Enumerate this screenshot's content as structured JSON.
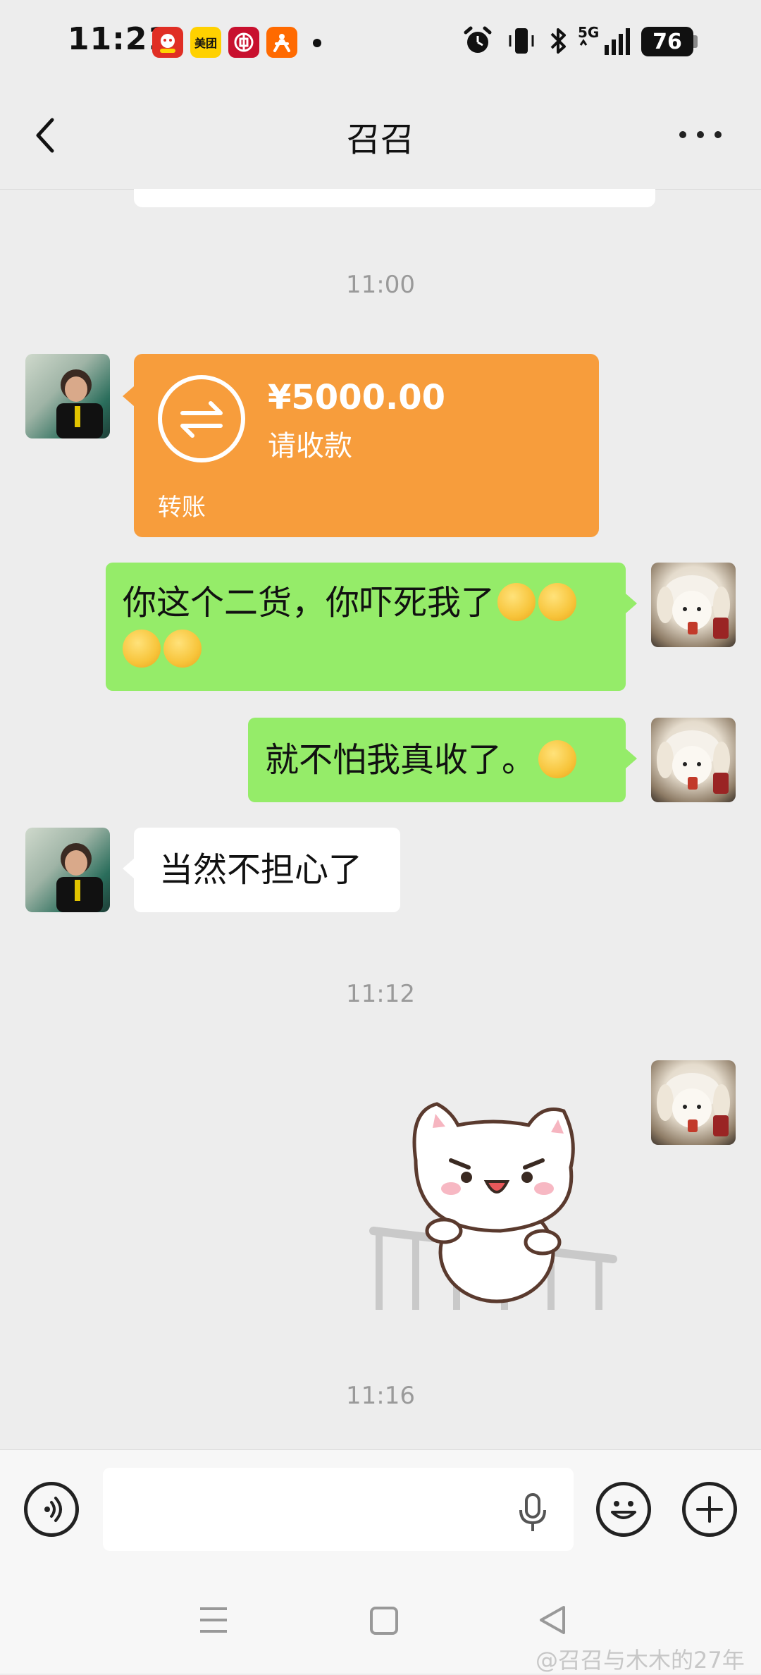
{
  "status_bar": {
    "time": "11:21",
    "app_icons": [
      {
        "name": "pinduoduo-icon",
        "color": "#e02e24"
      },
      {
        "name": "meituan-icon",
        "label": "美团",
        "color": "#ffd100"
      },
      {
        "name": "bank-icon",
        "color": "#c8102e"
      },
      {
        "name": "delivery-app-icon",
        "color": "#ff6a00"
      }
    ],
    "network": "5G",
    "battery": "76"
  },
  "header": {
    "title": "召召"
  },
  "messages": {
    "timestamp_1": "11:00",
    "transfer": {
      "amount": "¥5000.00",
      "status": "请收款",
      "label": "转账",
      "color": "#f79d3c"
    },
    "msg_1": "你这个二货，你吓死我了",
    "msg_2": "就不怕我真收了。",
    "msg_3": "当然不担心了",
    "timestamp_2": "11:12",
    "sticker": "cat-sticker",
    "timestamp_3": "11:16"
  },
  "colors": {
    "sent_bubble": "#95ec69",
    "received_bubble": "#ffffff",
    "background": "#ededed"
  },
  "input_bar": {
    "placeholder": ""
  },
  "watermark": "@召召与木木的27年"
}
